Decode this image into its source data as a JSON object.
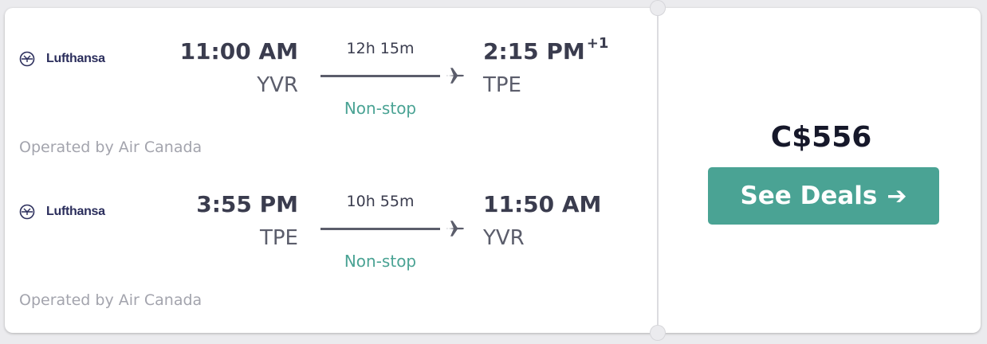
{
  "legs": [
    {
      "airline": "Lufthansa",
      "depart_time": "11:00 AM",
      "depart_code": "YVR",
      "duration": "12h 15m",
      "stops": "Non-stop",
      "arrive_time": "2:15 PM",
      "arrive_day_offset": "+1",
      "arrive_code": "TPE",
      "operated_by": "Operated by Air Canada"
    },
    {
      "airline": "Lufthansa",
      "depart_time": "3:55 PM",
      "depart_code": "TPE",
      "duration": "10h 55m",
      "stops": "Non-stop",
      "arrive_time": "11:50 AM",
      "arrive_day_offset": "",
      "arrive_code": "YVR",
      "operated_by": "Operated by Air Canada"
    }
  ],
  "price": "C$556",
  "cta": {
    "label": "See Deals",
    "icon": "arrow-right-icon"
  },
  "icons": {
    "airline_logo": "lufthansa-logo-icon",
    "plane": "plane-icon"
  },
  "colors": {
    "accent": "#4aa394",
    "text_dark": "#3a3c4e",
    "muted": "#a3a4ad",
    "brand_logo": "#2b2e5c"
  }
}
